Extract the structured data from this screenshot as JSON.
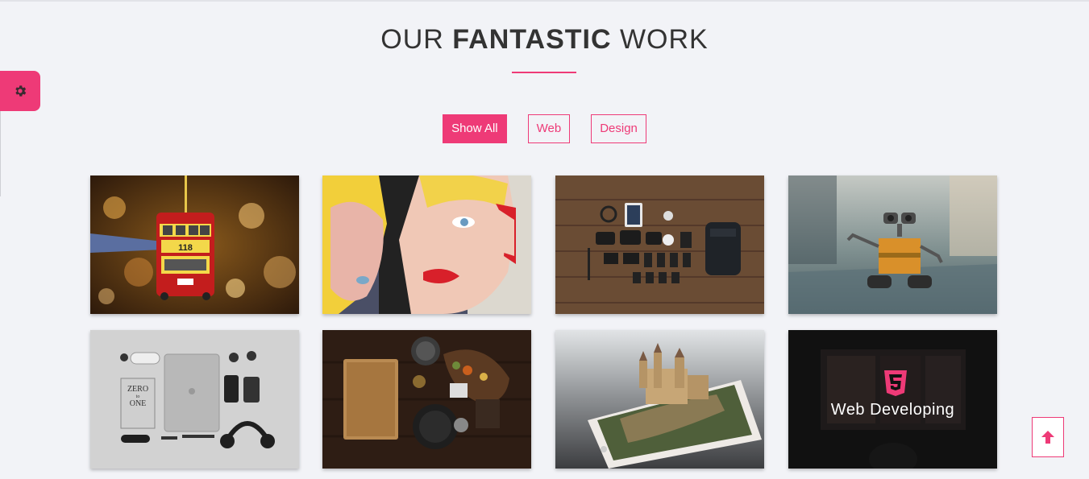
{
  "section": {
    "title_light_1": "OUR",
    "title_bold": "FANTASTIC",
    "title_light_2": "WORK"
  },
  "filters": [
    {
      "label": "Show All",
      "active": true
    },
    {
      "label": "Web",
      "active": false
    },
    {
      "label": "Design",
      "active": false
    }
  ],
  "portfolio": {
    "items": [
      {
        "icon": "bus-ornament-photo"
      },
      {
        "icon": "pop-art-faces-photo"
      },
      {
        "icon": "camera-gear-flatlay-photo"
      },
      {
        "icon": "walle-robot-photo"
      },
      {
        "icon": "laptop-flatlay-photo"
      },
      {
        "icon": "kitchen-table-photo"
      },
      {
        "icon": "phone-castle-photo"
      },
      {
        "icon": "css3-logo",
        "caption": "Web Developing"
      }
    ],
    "book_title_line1": "ZERO",
    "book_title_line2": "to",
    "book_title_line3": "ONE",
    "bus_number": "118"
  },
  "colors": {
    "accent": "#ee3a77",
    "background": "#f2f3f7",
    "heading": "#333333"
  },
  "widgets": {
    "settings_icon": "gear-icon",
    "scroll_icon": "arrow-up-icon"
  }
}
